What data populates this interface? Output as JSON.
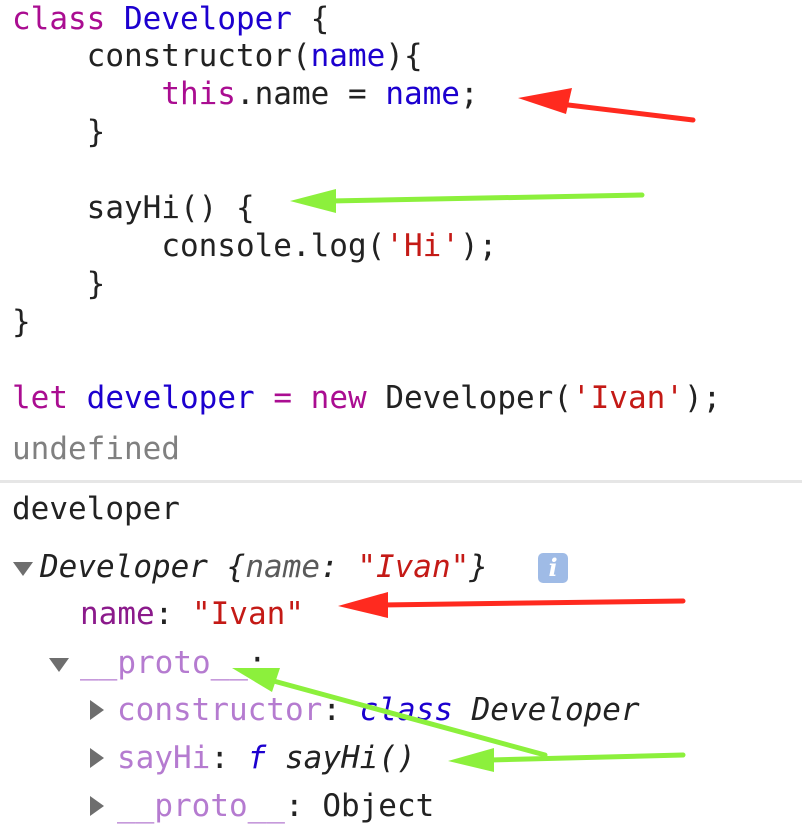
{
  "code": {
    "class_kw": "class",
    "class_name": "Developer",
    "open_brace": "{",
    "constructor_name": "constructor",
    "param": "name",
    "this_kw": "this",
    "dot_name": ".name",
    "assign": "=",
    "assign_value": "name",
    "semicolon": ";",
    "close_brace": "}",
    "method_name": "sayHi",
    "method_parens": "()",
    "console_call": "console.log(",
    "hi_string": "'Hi'",
    "call_end": ");",
    "let_kw": "let",
    "var_name": "developer",
    "new_kw": "new",
    "ctor_call": "Developer(",
    "ivan_string": "'Ivan'"
  },
  "console": {
    "result_undefined": "undefined",
    "input_expression": "developer",
    "object_summary_class": "Developer",
    "object_summary_open": "{",
    "object_summary_key": "name",
    "object_summary_value": "\"Ivan\"",
    "object_summary_close": "}",
    "info_icon_glyph": "i",
    "prop_name_key": "name",
    "prop_name_value": "\"Ivan\"",
    "proto_key": "__proto__",
    "constructor_key": "constructor",
    "constructor_kw": "class",
    "constructor_value": "Developer",
    "sayhi_key": "sayHi",
    "sayhi_f": "f",
    "sayhi_value": "sayHi()",
    "inner_proto_key": "__proto__",
    "inner_proto_value": "Object",
    "colon": ":"
  },
  "annotations": {
    "red_arrow_color": "#ff2a1f",
    "green_arrow_color": "#8cf03c"
  }
}
